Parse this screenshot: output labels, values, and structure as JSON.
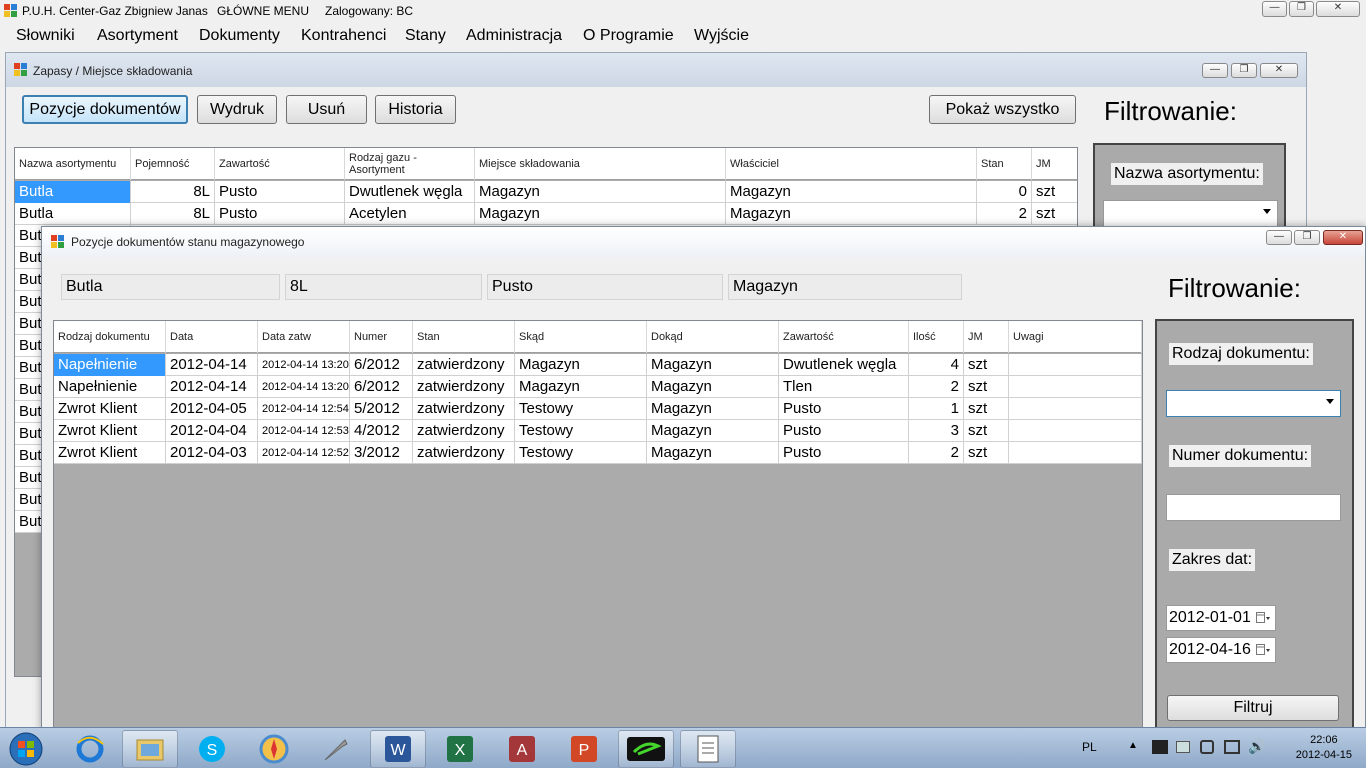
{
  "main_window": {
    "title_parts": [
      "P.U.H. Center-Gaz Zbigniew Janas",
      "GŁÓWNE MENU",
      "Zalogowany: BC"
    ],
    "controls": {
      "minimize": "—",
      "maximize": "❐",
      "close": "✕"
    }
  },
  "menu": [
    "Słowniki",
    "Asortyment",
    "Dokumenty",
    "Kontrahenci",
    "Stany",
    "Administracja",
    "O Programie",
    "Wyjście"
  ],
  "stock_window": {
    "title": "Zapasy / Miejsce składowania",
    "buttons": [
      "Pozycje dokumentów",
      "Wydruk",
      "Usuń",
      "Historia"
    ],
    "show_all_button": "Pokaż wszystko",
    "filter_title": "Filtrowanie:",
    "filter_label": "Nazwa asortymentu:",
    "columns": [
      "Nazwa asortymentu",
      "Pojemność",
      "Zawartość",
      "Rodzaj gazu - Asortyment",
      "Miejsce składowania",
      "Właściciel",
      "Stan",
      "JM"
    ],
    "rows": [
      [
        "Butla",
        "8L",
        "Pusto",
        "Dwutlenek węgla",
        "Magazyn",
        "Magazyn",
        "0",
        "szt"
      ],
      [
        "Butla",
        "8L",
        "Pusto",
        "Acetylen",
        "Magazyn",
        "Magazyn",
        "2",
        "szt"
      ]
    ],
    "hidden_row_prefix": "But",
    "hidden_row_count": 14
  },
  "positions_window": {
    "title": "Pozycje dokumentów stanu magazynowego",
    "info_fields": [
      "Butla",
      "8L",
      "Pusto",
      "Magazyn"
    ],
    "filter_title": "Filtrowanie:",
    "columns": [
      "Rodzaj dokumentu",
      "Data",
      "Data zatw",
      "Numer",
      "Stan",
      "Skąd",
      "Dokąd",
      "Zawartość",
      "Ilość",
      "JM",
      "Uwagi"
    ],
    "rows": [
      [
        "Napełnienie",
        "2012-04-14",
        "2012-04-14 13:20",
        "6/2012",
        "zatwierdzony",
        "Magazyn",
        "Magazyn",
        "Dwutlenek węgla",
        "4",
        "szt",
        ""
      ],
      [
        "Napełnienie",
        "2012-04-14",
        "2012-04-14 13:20",
        "6/2012",
        "zatwierdzony",
        "Magazyn",
        "Magazyn",
        "Tlen",
        "2",
        "szt",
        ""
      ],
      [
        "Zwrot Klient",
        "2012-04-05",
        "2012-04-14 12:54",
        "5/2012",
        "zatwierdzony",
        "Testowy",
        "Magazyn",
        "Pusto",
        "1",
        "szt",
        ""
      ],
      [
        "Zwrot Klient",
        "2012-04-04",
        "2012-04-14 12:53",
        "4/2012",
        "zatwierdzony",
        "Testowy",
        "Magazyn",
        "Pusto",
        "3",
        "szt",
        ""
      ],
      [
        "Zwrot Klient",
        "2012-04-03",
        "2012-04-14 12:52",
        "3/2012",
        "zatwierdzony",
        "Testowy",
        "Magazyn",
        "Pusto",
        "2",
        "szt",
        ""
      ]
    ],
    "filters": {
      "doc_type_label": "Rodzaj dokumentu:",
      "doc_type_value": "",
      "doc_number_label": "Numer dokumentu:",
      "doc_number_value": "",
      "date_range_label": "Zakres dat:",
      "date_from": "2012-01-01",
      "date_to": "2012-04-16",
      "filter_button": "Filtruj"
    }
  },
  "taskbar": {
    "apps": [
      "start-orb",
      "internet-explorer-icon",
      "file-explorer-icon",
      "skype-icon",
      "safari-icon",
      "tool-icon",
      "word-icon",
      "excel-icon",
      "access-icon",
      "powerpoint-icon",
      "razer-icon",
      "document-icon"
    ],
    "language": "PL",
    "time": "22:06",
    "date": "2012-04-15"
  },
  "colors": {
    "selection": "#3399ff",
    "grid_empty": "#ababab",
    "taskbar": "#a3bbd8"
  }
}
